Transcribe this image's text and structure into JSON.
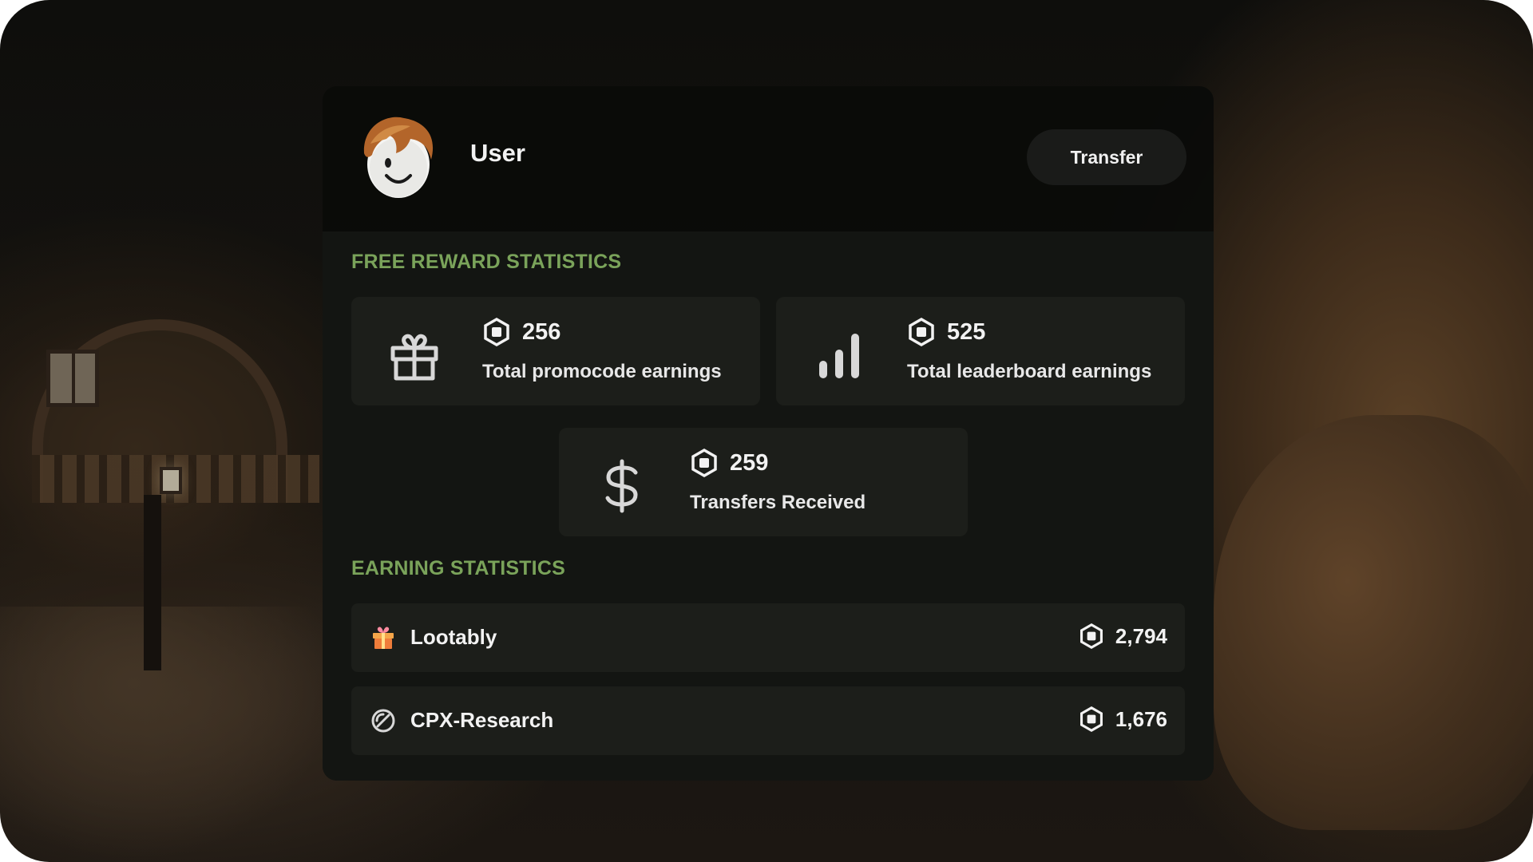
{
  "user": {
    "name": "User",
    "avatar_icon": "roblox-avatar"
  },
  "header": {
    "transfer_label": "Transfer"
  },
  "free_rewards": {
    "title": "FREE REWARD STATISTICS",
    "cards": [
      {
        "icon": "gift-icon",
        "value": "256",
        "label": "Total promocode earnings"
      },
      {
        "icon": "bar-chart-icon",
        "value": "525",
        "label": "Total leaderboard earnings"
      },
      {
        "icon": "dollar-icon",
        "value": "259",
        "label": "Transfers Received"
      }
    ]
  },
  "earnings": {
    "title": "EARNING STATISTICS",
    "rows": [
      {
        "icon": "lootably-gift-icon",
        "name": "Lootably",
        "amount": "2,794"
      },
      {
        "icon": "cpx-research-icon",
        "name": "CPX-Research",
        "amount": "1,676"
      }
    ]
  },
  "colors": {
    "accent": "#7aa35a",
    "panel": "#0a0b09",
    "card": "#1c1e1a"
  }
}
